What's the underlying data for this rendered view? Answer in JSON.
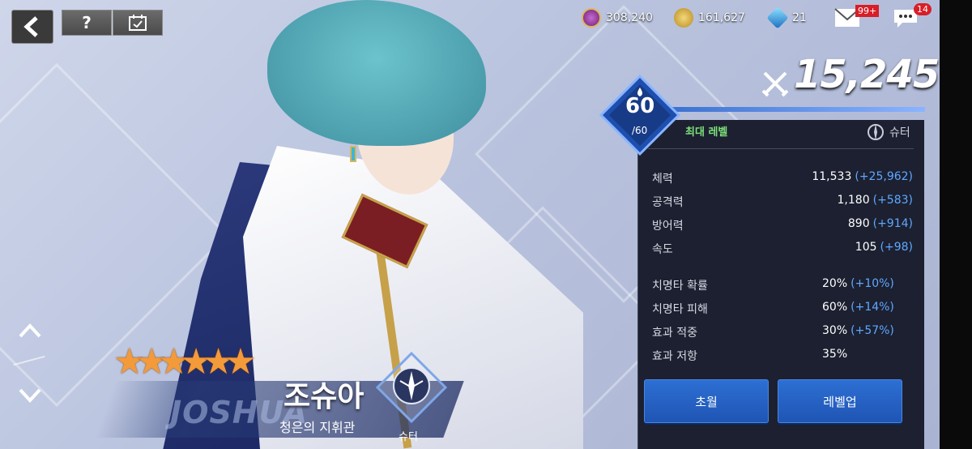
{
  "currencies": [
    {
      "name": "medal",
      "value": "308,240",
      "color": "#8e3a9b"
    },
    {
      "name": "gold",
      "value": "161,627",
      "color": "#d8b43a"
    },
    {
      "name": "crystal",
      "value": "21",
      "color": "#3aaee8"
    }
  ],
  "badges": {
    "mail": "99+",
    "chat": "14"
  },
  "character": {
    "name_ko": "조슈아",
    "name_en": "JOSHUA",
    "title_ko": "청은의 지휘관",
    "class_label": "슈터",
    "stars": 6
  },
  "level": {
    "current": "60",
    "max": "/60",
    "status": "최대 레벨"
  },
  "combat_power": "15,245",
  "stats": [
    {
      "label": "체력",
      "value": "11,533",
      "bonus": "(+25,962)"
    },
    {
      "label": "공격력",
      "value": "1,180",
      "bonus": "(+583)"
    },
    {
      "label": "방어력",
      "value": "890",
      "bonus": "(+914)"
    },
    {
      "label": "속도",
      "value": "105",
      "bonus": "(+98)"
    }
  ],
  "sub_stats": [
    {
      "label": "치명타 확률",
      "value": "20%",
      "bonus": "(+10%)"
    },
    {
      "label": "치명타 피해",
      "value": "60%",
      "bonus": "(+14%)"
    },
    {
      "label": "효과 적중",
      "value": "30%",
      "bonus": "(+57%)"
    },
    {
      "label": "효과 저항",
      "value": "35%",
      "bonus": ""
    }
  ],
  "buttons": {
    "transcend": "초월",
    "level_up": "레벨업"
  },
  "nav_icons": {
    "help": "?",
    "up": "^",
    "down": "v"
  },
  "colors": {
    "accent": "#2d6fd3",
    "bonus": "#5fa8ff",
    "max_level": "#7ee07a",
    "badge": "#d81e28"
  }
}
